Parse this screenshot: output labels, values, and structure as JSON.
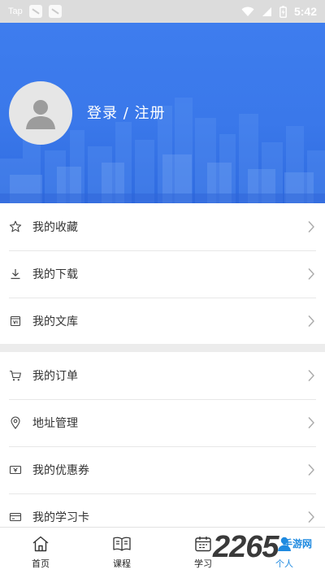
{
  "status_bar": {
    "app_label": "Tap",
    "time": "5:42"
  },
  "header": {
    "login_text": "登录 / 注册"
  },
  "menu_group_1": [
    {
      "label": "我的收藏",
      "icon": "star-icon"
    },
    {
      "label": "我的下载",
      "icon": "download-icon"
    },
    {
      "label": "我的文库",
      "icon": "library-icon"
    }
  ],
  "menu_group_2": [
    {
      "label": "我的订单",
      "icon": "cart-icon"
    },
    {
      "label": "地址管理",
      "icon": "location-pin-icon"
    },
    {
      "label": "我的优惠券",
      "icon": "coupon-icon"
    },
    {
      "label": "我的学习卡",
      "icon": "card-icon"
    }
  ],
  "tabbar": [
    {
      "label": "首页",
      "icon": "home-icon"
    },
    {
      "label": "课程",
      "icon": "book-icon"
    },
    {
      "label": "学习",
      "icon": "calendar-icon"
    },
    {
      "label": "个人",
      "icon": "person-icon"
    }
  ],
  "watermark": {
    "number": "2265",
    "site": "手游网"
  },
  "colors": {
    "header_blue": "#3a78ea",
    "background": "#ececec",
    "text": "#333333"
  }
}
